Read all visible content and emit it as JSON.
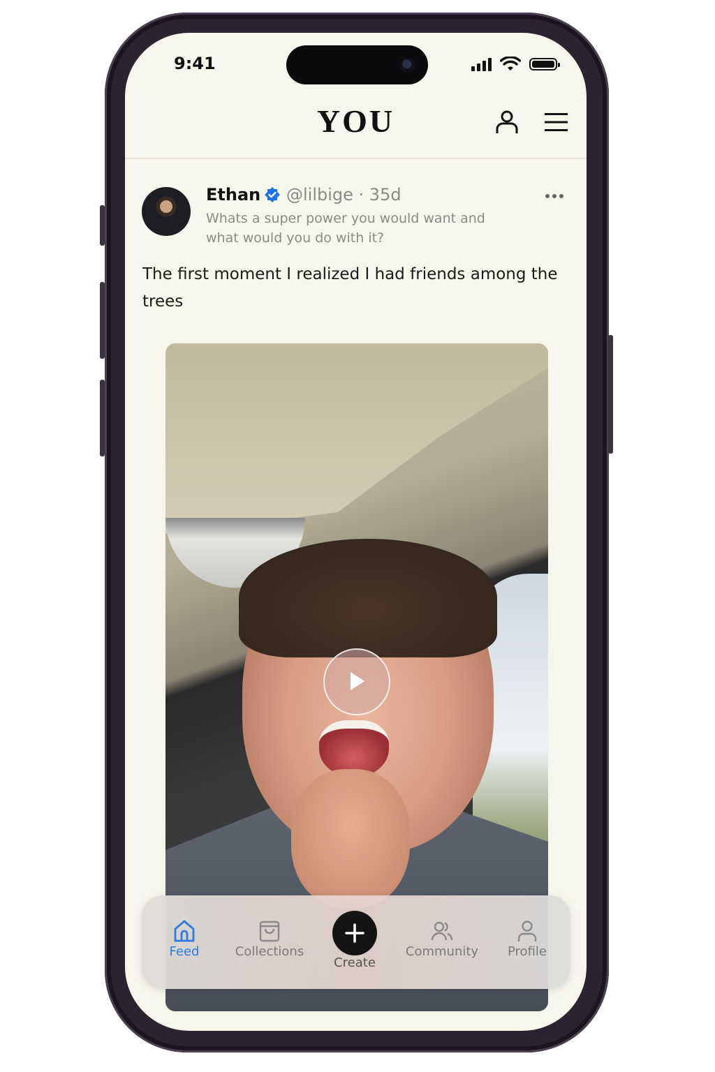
{
  "status_bar": {
    "time": "9:41"
  },
  "header": {
    "logo": "YOU"
  },
  "post": {
    "author_name": "Ethan",
    "handle_age": "@lilbige · 35d",
    "prompt": "Whats a super power you would want and what would you do with it?",
    "body": "The first moment I realized I had friends among the trees"
  },
  "tabs": [
    {
      "label": "Feed",
      "icon": "home-icon",
      "active": true
    },
    {
      "label": "Collections",
      "icon": "bag-icon",
      "active": false
    },
    {
      "label": "Create",
      "icon": "plus-icon",
      "active": false
    },
    {
      "label": "Community",
      "icon": "people-icon",
      "active": false
    },
    {
      "label": "Profile",
      "icon": "person-icon",
      "active": false
    }
  ],
  "colors": {
    "accent": "#2d7be0",
    "background": "#f7f6ec",
    "verified": "#1d74e6"
  }
}
